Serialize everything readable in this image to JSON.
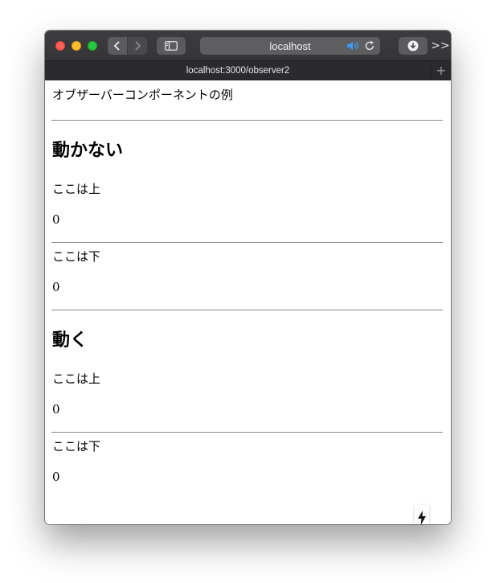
{
  "browser": {
    "url_host": "localhost",
    "tab_title": "localhost:3000/observer2",
    "more_label": ">>",
    "new_tab_label": "+"
  },
  "page": {
    "intro": "オブザーバーコンポーネントの例",
    "sections": [
      {
        "heading": "動かない",
        "top_label": "ここは上",
        "top_value": "0",
        "bottom_label": "ここは下",
        "bottom_value": "0"
      },
      {
        "heading": "動く",
        "top_label": "ここは上",
        "top_value": "0",
        "bottom_label": "ここは下",
        "bottom_value": "0"
      }
    ],
    "buttons": {
      "increment_label": "+",
      "decrement_label": "-"
    }
  },
  "icons": {
    "back": "chevron-left-icon",
    "forward": "chevron-right-icon",
    "sidebar": "sidebar-icon",
    "speaker": "speaker-icon",
    "reload": "reload-icon",
    "download": "download-icon",
    "lightning": "lightning-icon"
  },
  "colors": {
    "speaker_accent": "#3b9cf2",
    "titlebar": "#3a3a3c",
    "tabbar": "#2b2b2d"
  }
}
